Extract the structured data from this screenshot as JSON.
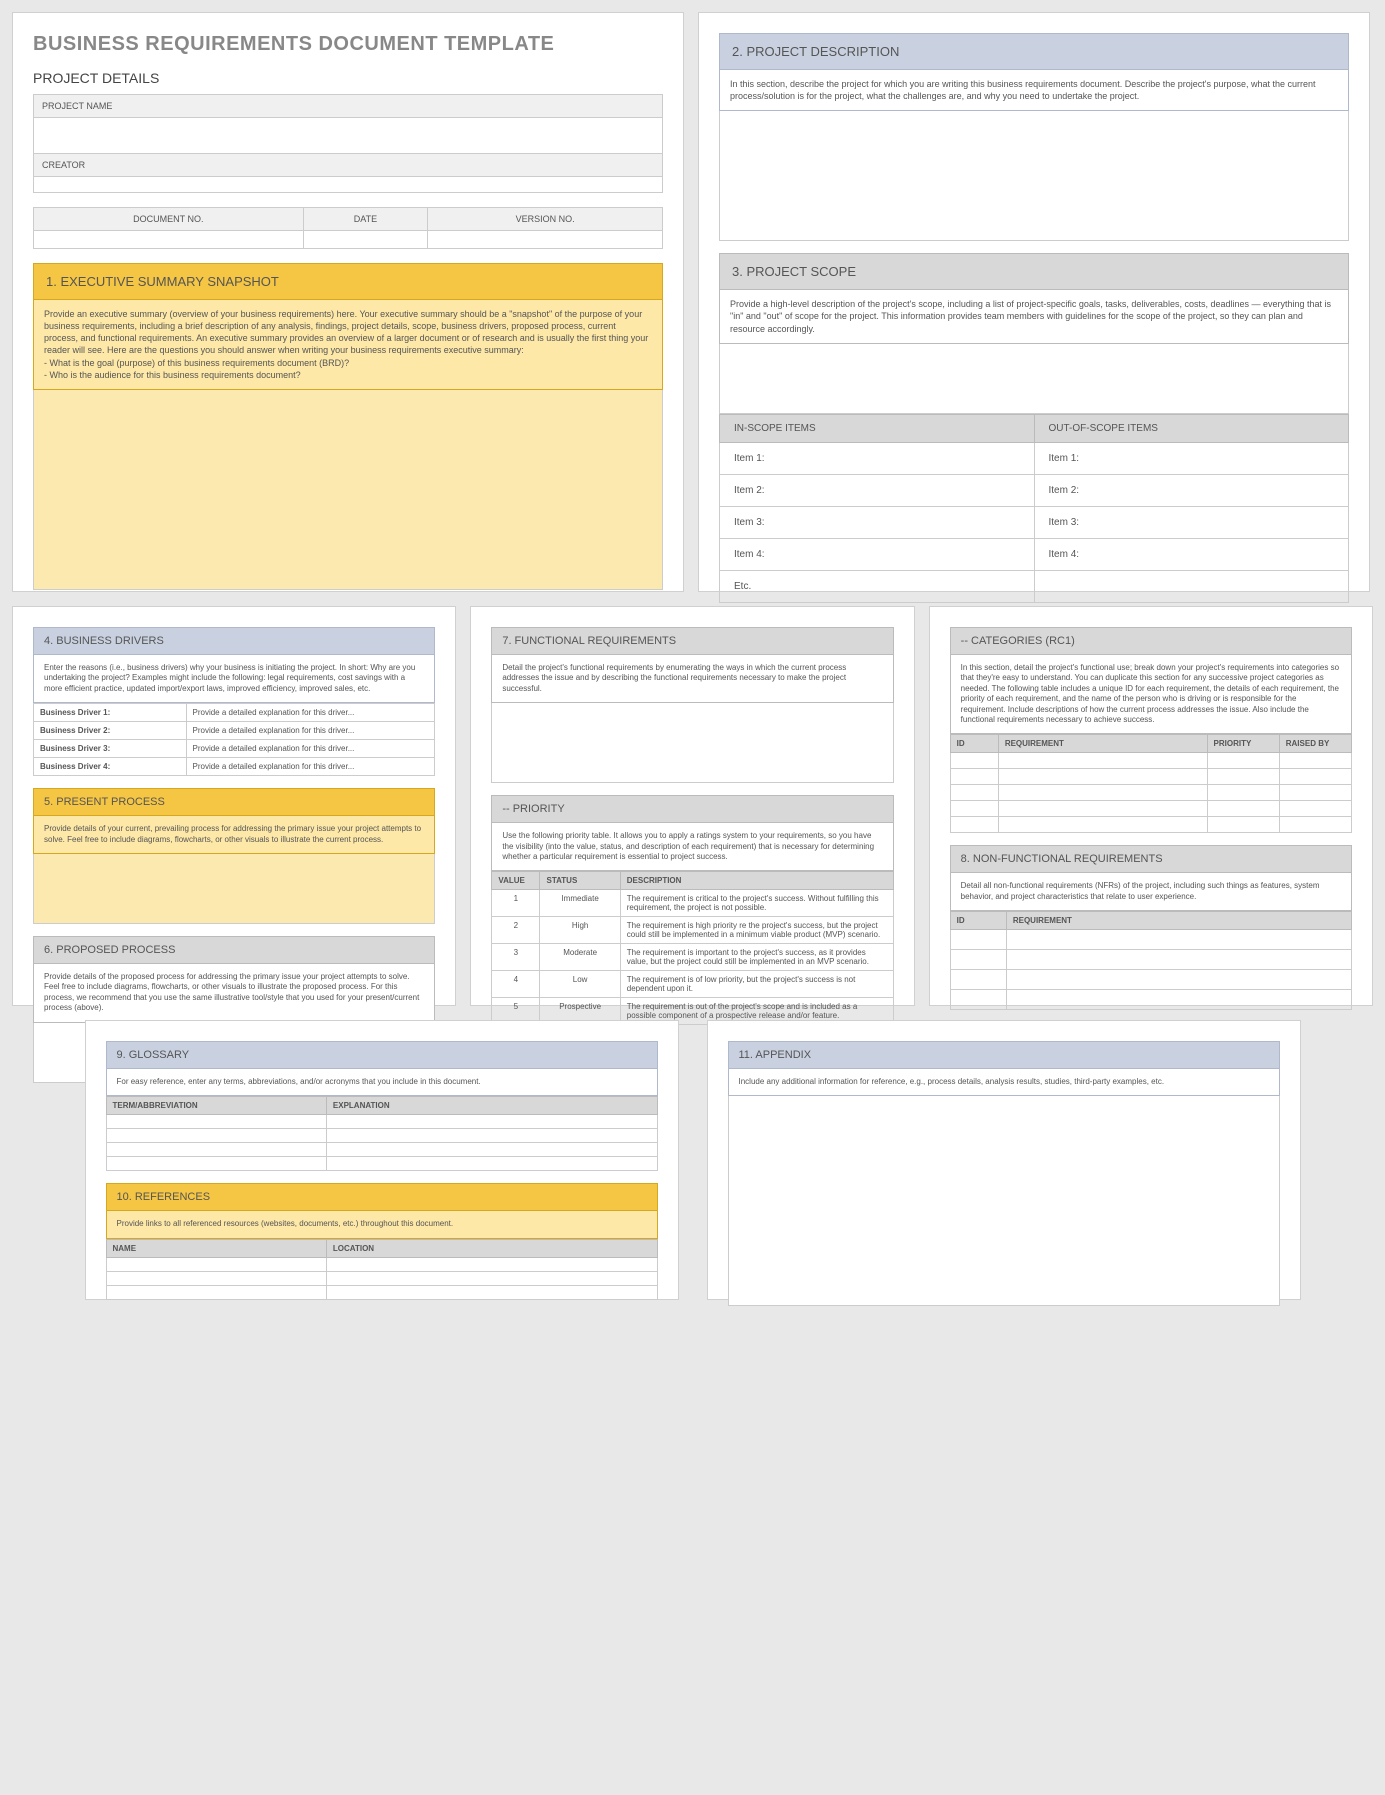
{
  "title": "BUSINESS REQUIREMENTS DOCUMENT TEMPLATE",
  "details": {
    "heading": "PROJECT DETAILS",
    "pn": "PROJECT NAME",
    "cr": "CREATOR",
    "dn": "DOCUMENT NO.",
    "dt": "DATE",
    "vn": "VERSION NO."
  },
  "s1": {
    "h": "1. EXECUTIVE SUMMARY SNAPSHOT",
    "t": "Provide an executive summary (overview of your business requirements) here. Your executive summary should be a \"snapshot\" of the purpose of your business requirements, including a brief description of any analysis, findings, project details, scope, business drivers, proposed process, current process, and functional requirements. An executive summary provides an overview of a larger document or of research and is usually the first thing your reader will see. Here are the questions you should answer when writing your business requirements executive summary:",
    "b1": "- What is the goal (purpose) of this business requirements document (BRD)?",
    "b2": "- Who is the audience for this business requirements document?"
  },
  "s2": {
    "h": "2. PROJECT DESCRIPTION",
    "t": "In this section, describe the project for which you are writing this business requirements document. Describe the project's purpose, what the current process/solution is for the project, what the challenges are, and why you need to undertake the project."
  },
  "s3": {
    "h": "3. PROJECT SCOPE",
    "t": "Provide a high-level description of the project's scope, including a list of project-specific goals, tasks, deliverables, costs, deadlines — everything that is \"in\" and \"out\" of scope for the project. This information provides team members with guidelines for the scope of the project, so they can plan and resource accordingly.",
    "in": "IN-SCOPE ITEMS",
    "out": "OUT-OF-SCOPE ITEMS",
    "rows": [
      "Item 1:",
      "Item 2:",
      "Item 3:",
      "Item 4:",
      "Etc."
    ]
  },
  "s4": {
    "h": "4. BUSINESS DRIVERS",
    "t": "Enter the reasons (i.e., business drivers) why your business is initiating the project. In short: Why are you undertaking the project? Examples might include the following: legal requirements, cost savings with a more efficient practice, updated import/export laws, improved efficiency, improved sales, etc.",
    "rows": [
      [
        "Business Driver 1:",
        "Provide a detailed explanation for this driver..."
      ],
      [
        "Business Driver 2:",
        "Provide a detailed explanation for this driver..."
      ],
      [
        "Business Driver 3:",
        "Provide a detailed explanation for this driver..."
      ],
      [
        "Business Driver 4:",
        "Provide a detailed explanation for this driver..."
      ]
    ]
  },
  "s5": {
    "h": "5. PRESENT PROCESS",
    "t": "Provide details of your current, prevailing process for addressing the primary issue your project attempts to solve. Feel free to include diagrams, flowcharts, or other visuals to illustrate the current process."
  },
  "s6": {
    "h": "6. PROPOSED PROCESS",
    "t": "Provide details of the proposed process for addressing the primary issue your project attempts to solve. Feel free to include diagrams, flowcharts, or other visuals to illustrate the proposed process. For this process, we recommend that you use the same illustrative tool/style that you used for your present/current process (above)."
  },
  "s7": {
    "h": "7. FUNCTIONAL REQUIREMENTS",
    "t": "Detail the project's functional requirements by enumerating the ways in which the current process addresses the issue and by describing the functional requirements necessary to make the project successful."
  },
  "pri": {
    "h": "-- PRIORITY",
    "t": "Use the following priority table. It allows you to apply a ratings system to your requirements, so you have the visibility (into the value, status, and description of each requirement) that is necessary for determining whether a particular requirement is essential to project success.",
    "cols": [
      "VALUE",
      "STATUS",
      "DESCRIPTION"
    ],
    "rows": [
      [
        "1",
        "Immediate",
        "The requirement is critical to the project's success. Without fulfilling this requirement, the project is not possible."
      ],
      [
        "2",
        "High",
        "The requirement is high priority re the project's success, but the project could still be implemented in a minimum viable product (MVP) scenario."
      ],
      [
        "3",
        "Moderate",
        "The requirement is important to the project's success, as it provides value, but the project could still be implemented in an MVP scenario."
      ],
      [
        "4",
        "Low",
        "The requirement is of low priority, but the project's success is not dependent upon it."
      ],
      [
        "5",
        "Prospective",
        "The requirement is out of the project's scope and is included as a possible component of a prospective release and/or feature."
      ]
    ]
  },
  "cat": {
    "h": "-- CATEGORIES (RC1)",
    "t": "In this section, detail the project's functional use; break down your project's requirements into categories so that they're easy to understand. You can duplicate this section for any successive project categories as needed. The following table includes a unique ID for each requirement, the details of each requirement, the priority of each requirement, and the name of the person who is driving or is responsible for the requirement. Include descriptions of how the current process addresses the issue. Also include the functional requirements necessary to achieve success.",
    "cols": [
      "ID",
      "REQUIREMENT",
      "PRIORITY",
      "RAISED BY"
    ]
  },
  "s8": {
    "h": "8. NON-FUNCTIONAL REQUIREMENTS",
    "t": "Detail all non-functional requirements (NFRs) of the project, including such things as features, system behavior, and project characteristics that relate to user experience.",
    "cols": [
      "ID",
      "REQUIREMENT"
    ]
  },
  "s9": {
    "h": "9. GLOSSARY",
    "t": "For easy reference, enter any terms, abbreviations, and/or acronyms that you include in this document.",
    "cols": [
      "TERM/ABBREVIATION",
      "EXPLANATION"
    ]
  },
  "s10": {
    "h": "10. REFERENCES",
    "t": "Provide links to all referenced resources (websites, documents, etc.) throughout this document.",
    "cols": [
      "NAME",
      "LOCATION"
    ]
  },
  "s11": {
    "h": "11. APPENDIX",
    "t": "Include any additional information for reference, e.g., process details, analysis results, studies, third-party examples, etc."
  }
}
